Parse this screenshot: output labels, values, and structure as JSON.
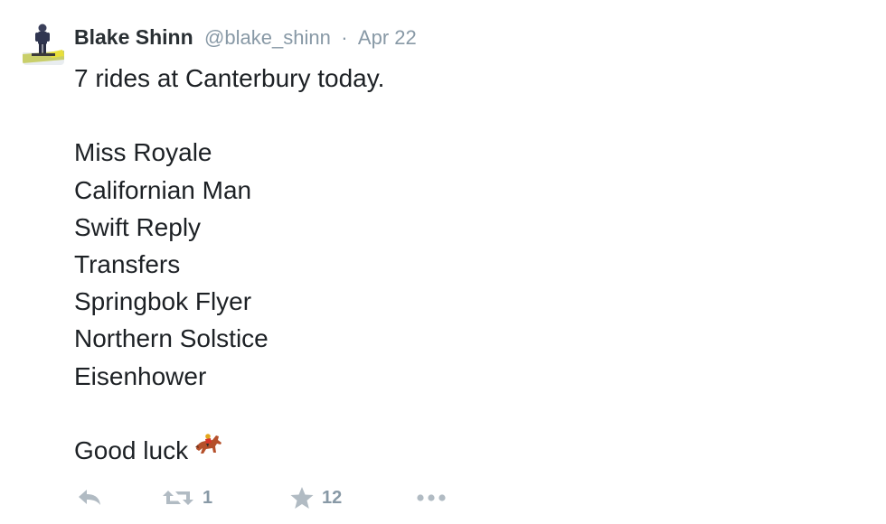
{
  "tweet": {
    "author_name": "Blake Shinn",
    "author_handle": "@blake_shinn",
    "separator": "·",
    "date": "Apr 22",
    "text_lines": [
      "7 rides at Canterbury today.",
      "",
      "Miss Royale",
      "Californian Man",
      "Swift Reply",
      "Transfers",
      "Springbok Flyer",
      "Northern Solstice",
      "Eisenhower",
      "",
      "Good luck"
    ],
    "emoji": "horse-racing-emoji",
    "avatar_icon": "jockey-avatar"
  },
  "actions": {
    "reply_icon": "reply-icon",
    "retweet_icon": "retweet-icon",
    "retweet_count": "1",
    "favorite_icon": "star-icon",
    "favorite_count": "12",
    "more_icon": "more-dots-icon"
  },
  "colors": {
    "name": "#292f33",
    "meta": "#8899a6",
    "action_icon": "#b1bbc3",
    "text": "#1d2125"
  }
}
